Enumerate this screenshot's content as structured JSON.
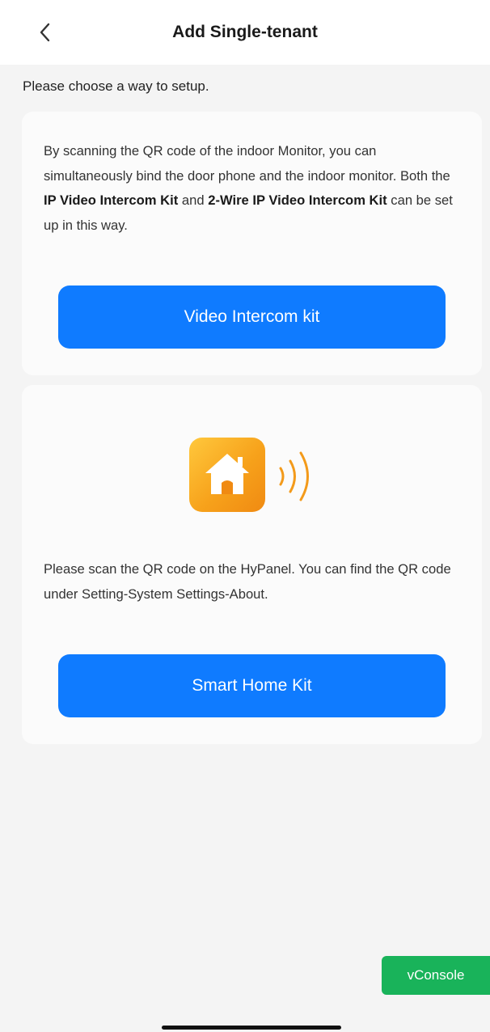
{
  "header": {
    "title": "Add Single-tenant",
    "back_icon": "chevron-left-icon"
  },
  "prompt": "Please choose a way to setup.",
  "card1": {
    "text_parts": [
      "By scanning the QR code of the indoor Monitor, you can simultaneously bind the door phone and the indoor monitor. Both the ",
      "IP Video Intercom Kit",
      " and ",
      "2-Wire IP Video Intercom Kit",
      " can be set up in this way."
    ],
    "button_label": "Video Intercom kit"
  },
  "card2": {
    "icon": "smart-home-icon",
    "signal_icon": "signal-waves-icon",
    "text": "Please scan the QR code on the HyPanel. You can find the QR code under Setting-System Settings-About.",
    "button_label": "Smart Home Kit"
  },
  "vconsole_label": "vConsole",
  "colors": {
    "button": "#0f7bff",
    "vconsole": "#19b35a",
    "icon_orange": "#f7a21b",
    "background": "#f4f4f4"
  }
}
